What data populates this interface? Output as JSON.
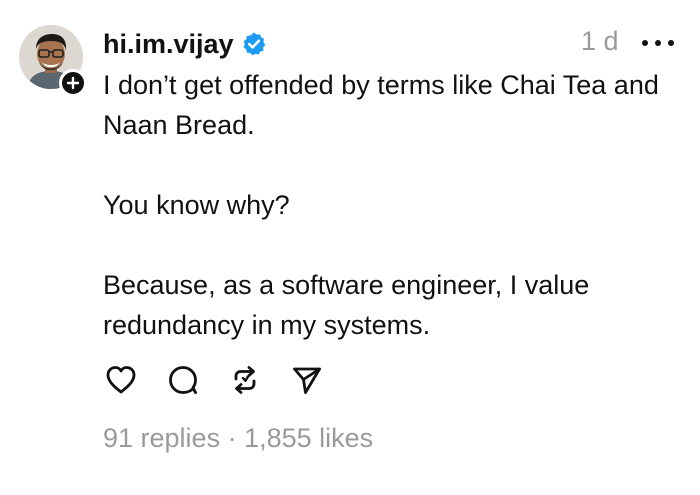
{
  "post": {
    "author": {
      "username": "hi.im.vijay",
      "verified": true,
      "avatar_icon": "avatar-photo",
      "follow_icon": "plus-icon"
    },
    "timestamp": "1 d",
    "more_icon": "more-horizontal-icon",
    "paragraphs": [
      "I don’t get offended by terms like Chai Tea and Naan Bread.",
      "You know why?",
      "Because, as a software engineer, I value redundancy in my systems."
    ],
    "actions": [
      {
        "name": "like",
        "icon": "heart-icon"
      },
      {
        "name": "reply",
        "icon": "comment-icon"
      },
      {
        "name": "repost",
        "icon": "repost-icon"
      },
      {
        "name": "share",
        "icon": "send-icon"
      }
    ],
    "stats": {
      "replies": "91 replies",
      "separator": " · ",
      "likes": "1,855 likes"
    },
    "colors": {
      "verified": "#1d9bf0",
      "muted": "#9a9a9a",
      "text": "#111111"
    }
  }
}
